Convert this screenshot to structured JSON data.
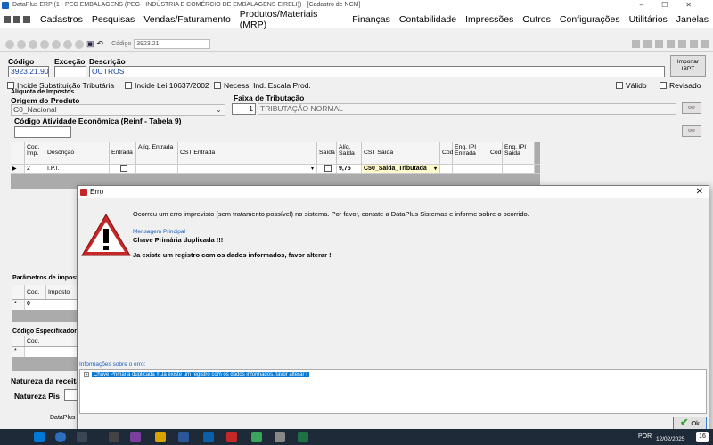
{
  "window": {
    "title": "DataPlus ERP (1 - PEG EMBALAGENS  (PEG - INDÚSTRIA E COMÉRCIO DE EMBALAGENS EIRELI)) - [Cadastro de NCM]",
    "controls": [
      "–",
      "☐",
      "✕"
    ]
  },
  "menu": [
    "Cadastros",
    "Pesquisas",
    "Vendas/Faturamento",
    "Produtos/Materiais (MRP)",
    "Finanças",
    "Contabilidade",
    "Impressões",
    "Outros",
    "Configurações",
    "Utilitários",
    "Janelas"
  ],
  "toolbar": {
    "search_label": "Código",
    "search_value": "3923.21"
  },
  "form": {
    "codigo_label": "Código",
    "codigo_value": "3923.21.90",
    "excecao_label": "Exceção",
    "excecao_value": "",
    "descricao_label": "Descrição",
    "descricao_value": "OUTROS",
    "importar_label": "Importar IBPT",
    "cb_incide_subst": "Incide Substituição Tributária",
    "cb_incide_lei": "Incide Lei 10637/2002",
    "cb_necess_escala": "Necess. Ind. Escala Prod.",
    "cb_valido": "Válido",
    "cb_revisado": "Revisado",
    "aliquota_label": "Alíquota de Impostos",
    "origem_label": "Origem do Produto",
    "origem_value": "C0_Nacional",
    "faixa_label": "Faixa de Tributação",
    "faixa_num": "1",
    "faixa_value": "TRIBUTAÇÃO NORMAL",
    "atividade_label": "Código Atividade Econômica (Reinf - Tabela 9)",
    "atividade_value": "",
    "parametros_label": "Parâmetros de impostos",
    "cod_especificador_label": "Código Especificador d",
    "natureza_receita_label": "Natureza da receita",
    "natureza_pis_label": "Natureza Pis"
  },
  "tax_grid": {
    "headers": [
      "Cod. Imp.",
      "Descrição",
      "Entrada",
      "Alíq. Entrada",
      "CST Entrada",
      "Saída",
      "Alíq. Saída",
      "CST Saída",
      "Cod",
      "Enq. IPI Entrada",
      "Cod",
      "Enq. IPI Saída"
    ],
    "row": {
      "cod": "2",
      "descricao": "I.P.I.",
      "aliq_saida": "9,75",
      "cst_saida": "C50_Saida_Tributada"
    }
  },
  "param_grid": {
    "headers": [
      "Cod.",
      "Imposto"
    ],
    "row_value": "0",
    "row_marker": "*"
  },
  "spec_grid": {
    "headers": [
      "Cod."
    ],
    "row_marker": "*"
  },
  "dialog": {
    "title": "Erro",
    "message": "Ocorreu um erro imprevisto (sem tratamento possível) no sistema. Por favor, contate a DataPlus Sistemas e informe sobre o ocorrido.",
    "principal_label": "Mensagem Principal",
    "principal_text": "Chave Primária duplicada !!!",
    "detail_text": "Ja existe um registro com os dados informados, favor alterar !",
    "info_label": "Informações sobre o erro:",
    "info_tree_item": "Chave Primária duplicada !!!Ja existe um registro com os dados informados, favor alterar !",
    "ok_label": "Ok"
  },
  "bottom_label": "DataPlus",
  "taskbar": {
    "lang": "POR",
    "date": "12/02/2025",
    "badge": "16"
  },
  "colors": {
    "warning_red": "#c62828",
    "selection_blue": "#0078d7",
    "highlight_yellow": "#fffbcc"
  }
}
